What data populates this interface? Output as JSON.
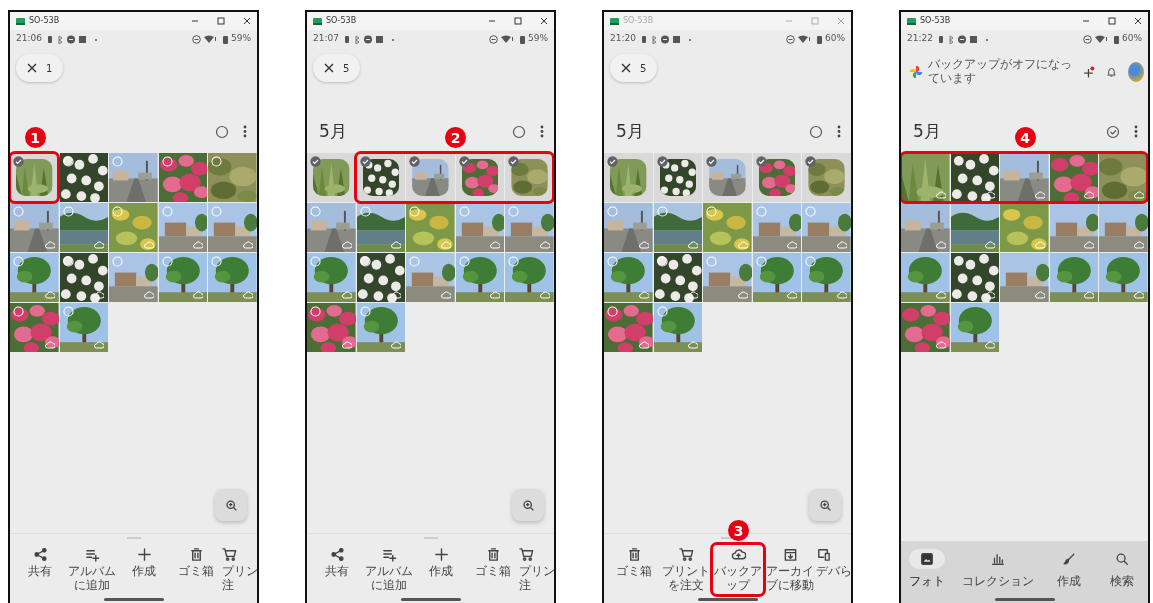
{
  "phones": [
    {
      "window_title": "SO-53B",
      "window_active": true,
      "time": "21:06",
      "battery": "59%",
      "header": {
        "kind": "selection",
        "count": "1"
      },
      "month_check": false,
      "step": "1",
      "zoom_button": true,
      "photos": [
        {
          "selected": true,
          "cloud": false,
          "highlighted": true
        },
        {
          "selected": false,
          "cloud": false,
          "highlighted": false
        },
        {
          "selected": false,
          "cloud": false,
          "highlighted": false
        },
        {
          "selected": false,
          "cloud": false,
          "highlighted": false
        },
        {
          "selected": false,
          "cloud": false,
          "highlighted": false
        },
        {
          "selected": false,
          "cloud": true,
          "highlighted": false
        },
        {
          "selected": false,
          "cloud": true,
          "highlighted": false
        },
        {
          "selected": false,
          "cloud": true,
          "highlighted": false
        },
        {
          "selected": false,
          "cloud": true,
          "highlighted": false
        },
        {
          "selected": false,
          "cloud": true,
          "highlighted": false
        },
        {
          "selected": false,
          "cloud": true,
          "highlighted": false
        },
        {
          "selected": false,
          "cloud": true,
          "highlighted": false
        },
        {
          "selected": false,
          "cloud": true,
          "highlighted": false
        },
        {
          "selected": false,
          "cloud": true,
          "highlighted": false
        },
        {
          "selected": false,
          "cloud": true,
          "highlighted": false
        },
        {
          "selected": false,
          "cloud": true,
          "highlighted": false
        },
        {
          "selected": false,
          "cloud": true,
          "highlighted": false
        }
      ],
      "actions": [
        {
          "kind": "share",
          "label": "共有",
          "highlighted": false
        },
        {
          "kind": "album_add",
          "label": "アルバムに追加",
          "highlighted": false
        },
        {
          "kind": "create",
          "label": "作成",
          "highlighted": false
        },
        {
          "kind": "trash",
          "label": "ゴミ箱",
          "highlighted": false
        },
        {
          "kind": "print",
          "label": "プリン注",
          "highlighted": false
        }
      ]
    },
    {
      "window_title": "SO-53B",
      "window_active": true,
      "time": "21:07",
      "battery": "59%",
      "header": {
        "kind": "selection",
        "count": "5"
      },
      "month": "5月",
      "month_check": false,
      "step": "2",
      "zoom_button": true,
      "photos": [
        {
          "selected": true,
          "cloud": false,
          "highlighted": false
        },
        {
          "selected": true,
          "cloud": false,
          "highlighted": true
        },
        {
          "selected": true,
          "cloud": false,
          "highlighted": true
        },
        {
          "selected": true,
          "cloud": false,
          "highlighted": true
        },
        {
          "selected": true,
          "cloud": false,
          "highlighted": true
        },
        {
          "selected": false,
          "cloud": true,
          "highlighted": false
        },
        {
          "selected": false,
          "cloud": true,
          "highlighted": false
        },
        {
          "selected": false,
          "cloud": true,
          "highlighted": false
        },
        {
          "selected": false,
          "cloud": true,
          "highlighted": false
        },
        {
          "selected": false,
          "cloud": true,
          "highlighted": false
        },
        {
          "selected": false,
          "cloud": true,
          "highlighted": false
        },
        {
          "selected": false,
          "cloud": true,
          "highlighted": false
        },
        {
          "selected": false,
          "cloud": true,
          "highlighted": false
        },
        {
          "selected": false,
          "cloud": true,
          "highlighted": false
        },
        {
          "selected": false,
          "cloud": true,
          "highlighted": false
        },
        {
          "selected": false,
          "cloud": true,
          "highlighted": false
        },
        {
          "selected": false,
          "cloud": true,
          "highlighted": false
        }
      ],
      "actions": [
        {
          "kind": "share",
          "label": "共有",
          "highlighted": false
        },
        {
          "kind": "album_add",
          "label": "アルバムに追加",
          "highlighted": false
        },
        {
          "kind": "create",
          "label": "作成",
          "highlighted": false
        },
        {
          "kind": "trash",
          "label": "ゴミ箱",
          "highlighted": false
        },
        {
          "kind": "print",
          "label": "プリン注",
          "highlighted": false
        }
      ]
    },
    {
      "window_title": "SO-53B",
      "window_active": false,
      "time": "21:20",
      "battery": "60%",
      "header": {
        "kind": "selection",
        "count": "5"
      },
      "month": "5月",
      "month_check": false,
      "step": "3",
      "zoom_button": true,
      "photos": [
        {
          "selected": true,
          "cloud": false,
          "highlighted": false
        },
        {
          "selected": true,
          "cloud": false,
          "highlighted": false
        },
        {
          "selected": true,
          "cloud": false,
          "highlighted": false
        },
        {
          "selected": true,
          "cloud": false,
          "highlighted": false
        },
        {
          "selected": true,
          "cloud": false,
          "highlighted": false
        },
        {
          "selected": false,
          "cloud": true,
          "highlighted": false
        },
        {
          "selected": false,
          "cloud": true,
          "highlighted": false
        },
        {
          "selected": false,
          "cloud": true,
          "highlighted": false
        },
        {
          "selected": false,
          "cloud": true,
          "highlighted": false
        },
        {
          "selected": false,
          "cloud": true,
          "highlighted": false
        },
        {
          "selected": false,
          "cloud": true,
          "highlighted": false
        },
        {
          "selected": false,
          "cloud": true,
          "highlighted": false
        },
        {
          "selected": false,
          "cloud": true,
          "highlighted": false
        },
        {
          "selected": false,
          "cloud": true,
          "highlighted": false
        },
        {
          "selected": false,
          "cloud": true,
          "highlighted": false
        },
        {
          "selected": false,
          "cloud": true,
          "highlighted": false
        },
        {
          "selected": false,
          "cloud": true,
          "highlighted": false
        }
      ],
      "actions": [
        {
          "kind": "trash",
          "label": "ゴミ箱",
          "highlighted": false
        },
        {
          "kind": "print",
          "label": "プリントを注文",
          "highlighted": false
        },
        {
          "kind": "backup",
          "label": "バックアップ",
          "highlighted": true
        },
        {
          "kind": "archive",
          "label": "アーカイブに移動",
          "highlighted": false
        },
        {
          "kind": "device",
          "label": "デバら",
          "highlighted": false
        }
      ]
    },
    {
      "window_title": "SO-53B",
      "window_active": true,
      "time": "21:22",
      "battery": "60%",
      "header": {
        "kind": "app",
        "title": "バックアップがオフになっています"
      },
      "month": "5月",
      "month_check": true,
      "step": "4",
      "photos": [
        {
          "cloud": true,
          "highlighted": true
        },
        {
          "cloud": true,
          "highlighted": true
        },
        {
          "cloud": true,
          "highlighted": true
        },
        {
          "cloud": true,
          "highlighted": true
        },
        {
          "cloud": true,
          "highlighted": true
        },
        {
          "cloud": true,
          "highlighted": false
        },
        {
          "cloud": true,
          "highlighted": false
        },
        {
          "cloud": true,
          "highlighted": false
        },
        {
          "cloud": true,
          "highlighted": false
        },
        {
          "cloud": true,
          "highlighted": false
        },
        {
          "cloud": true,
          "highlighted": false
        },
        {
          "cloud": true,
          "highlighted": false
        },
        {
          "cloud": true,
          "highlighted": false
        },
        {
          "cloud": true,
          "highlighted": false
        },
        {
          "cloud": true,
          "highlighted": false
        },
        {
          "cloud": true,
          "highlighted": false
        },
        {
          "cloud": true,
          "highlighted": false
        }
      ],
      "nav_tabs": [
        {
          "kind": "photos",
          "label": "フォト",
          "selected": true
        },
        {
          "kind": "collection",
          "label": "コレクション",
          "selected": false
        },
        {
          "kind": "create",
          "label": "作成",
          "selected": false
        },
        {
          "kind": "search",
          "label": "検索",
          "selected": false
        }
      ]
    }
  ]
}
